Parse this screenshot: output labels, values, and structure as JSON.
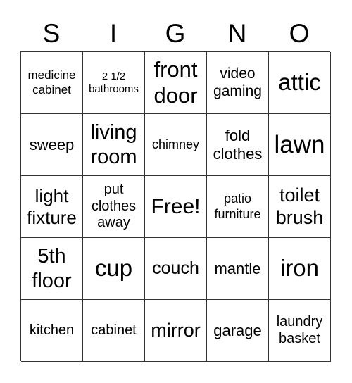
{
  "header": [
    "S",
    "I",
    "G",
    "N",
    "O"
  ],
  "cells": [
    [
      "medicine cabinet",
      "2 1/2 bathrooms",
      "front door",
      "video gaming",
      "attic"
    ],
    [
      "sweep",
      "living room",
      "chimney",
      "fold clothes",
      "lawn"
    ],
    [
      "light fixture",
      "put clothes away",
      "Free!",
      "patio furniture",
      "toilet brush"
    ],
    [
      "5th floor",
      "cup",
      "couch",
      "mantle",
      "iron"
    ],
    [
      "kitchen",
      "cabinet",
      "mirror",
      "garage",
      "laundry basket"
    ]
  ]
}
